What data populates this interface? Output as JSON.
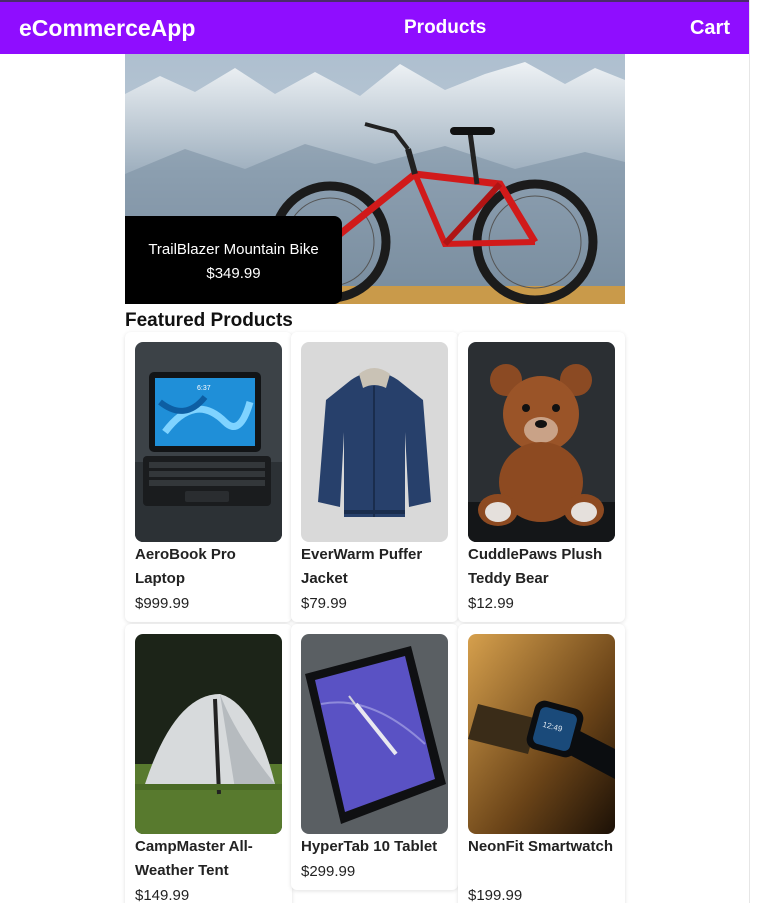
{
  "navbar": {
    "brand": "eCommerceApp",
    "products_link": "Products",
    "cart_link": "Cart",
    "background_color": "#8f0dff"
  },
  "hero": {
    "product_name": "TrailBlazer Mountain Bike",
    "price": "$349.99",
    "image_icon": "mountain-bike-photo"
  },
  "featured": {
    "title": "Featured Products",
    "products": [
      {
        "name": "AeroBook Pro Laptop",
        "price": "$999.99",
        "image_icon": "laptop-photo"
      },
      {
        "name": "EverWarm Puffer Jacket",
        "price": "$79.99",
        "image_icon": "jacket-photo"
      },
      {
        "name": "CuddlePaws Plush Teddy Bear",
        "price": "$12.99",
        "image_icon": "teddy-bear-photo"
      },
      {
        "name": "CampMaster All-Weather Tent",
        "price": "$149.99",
        "image_icon": "tent-photo"
      },
      {
        "name": "HyperTab 10 Tablet",
        "price": "$299.99",
        "image_icon": "tablet-photo"
      },
      {
        "name": "NeonFit Smartwatch",
        "price": "$199.99",
        "image_icon": "smartwatch-photo"
      }
    ]
  }
}
